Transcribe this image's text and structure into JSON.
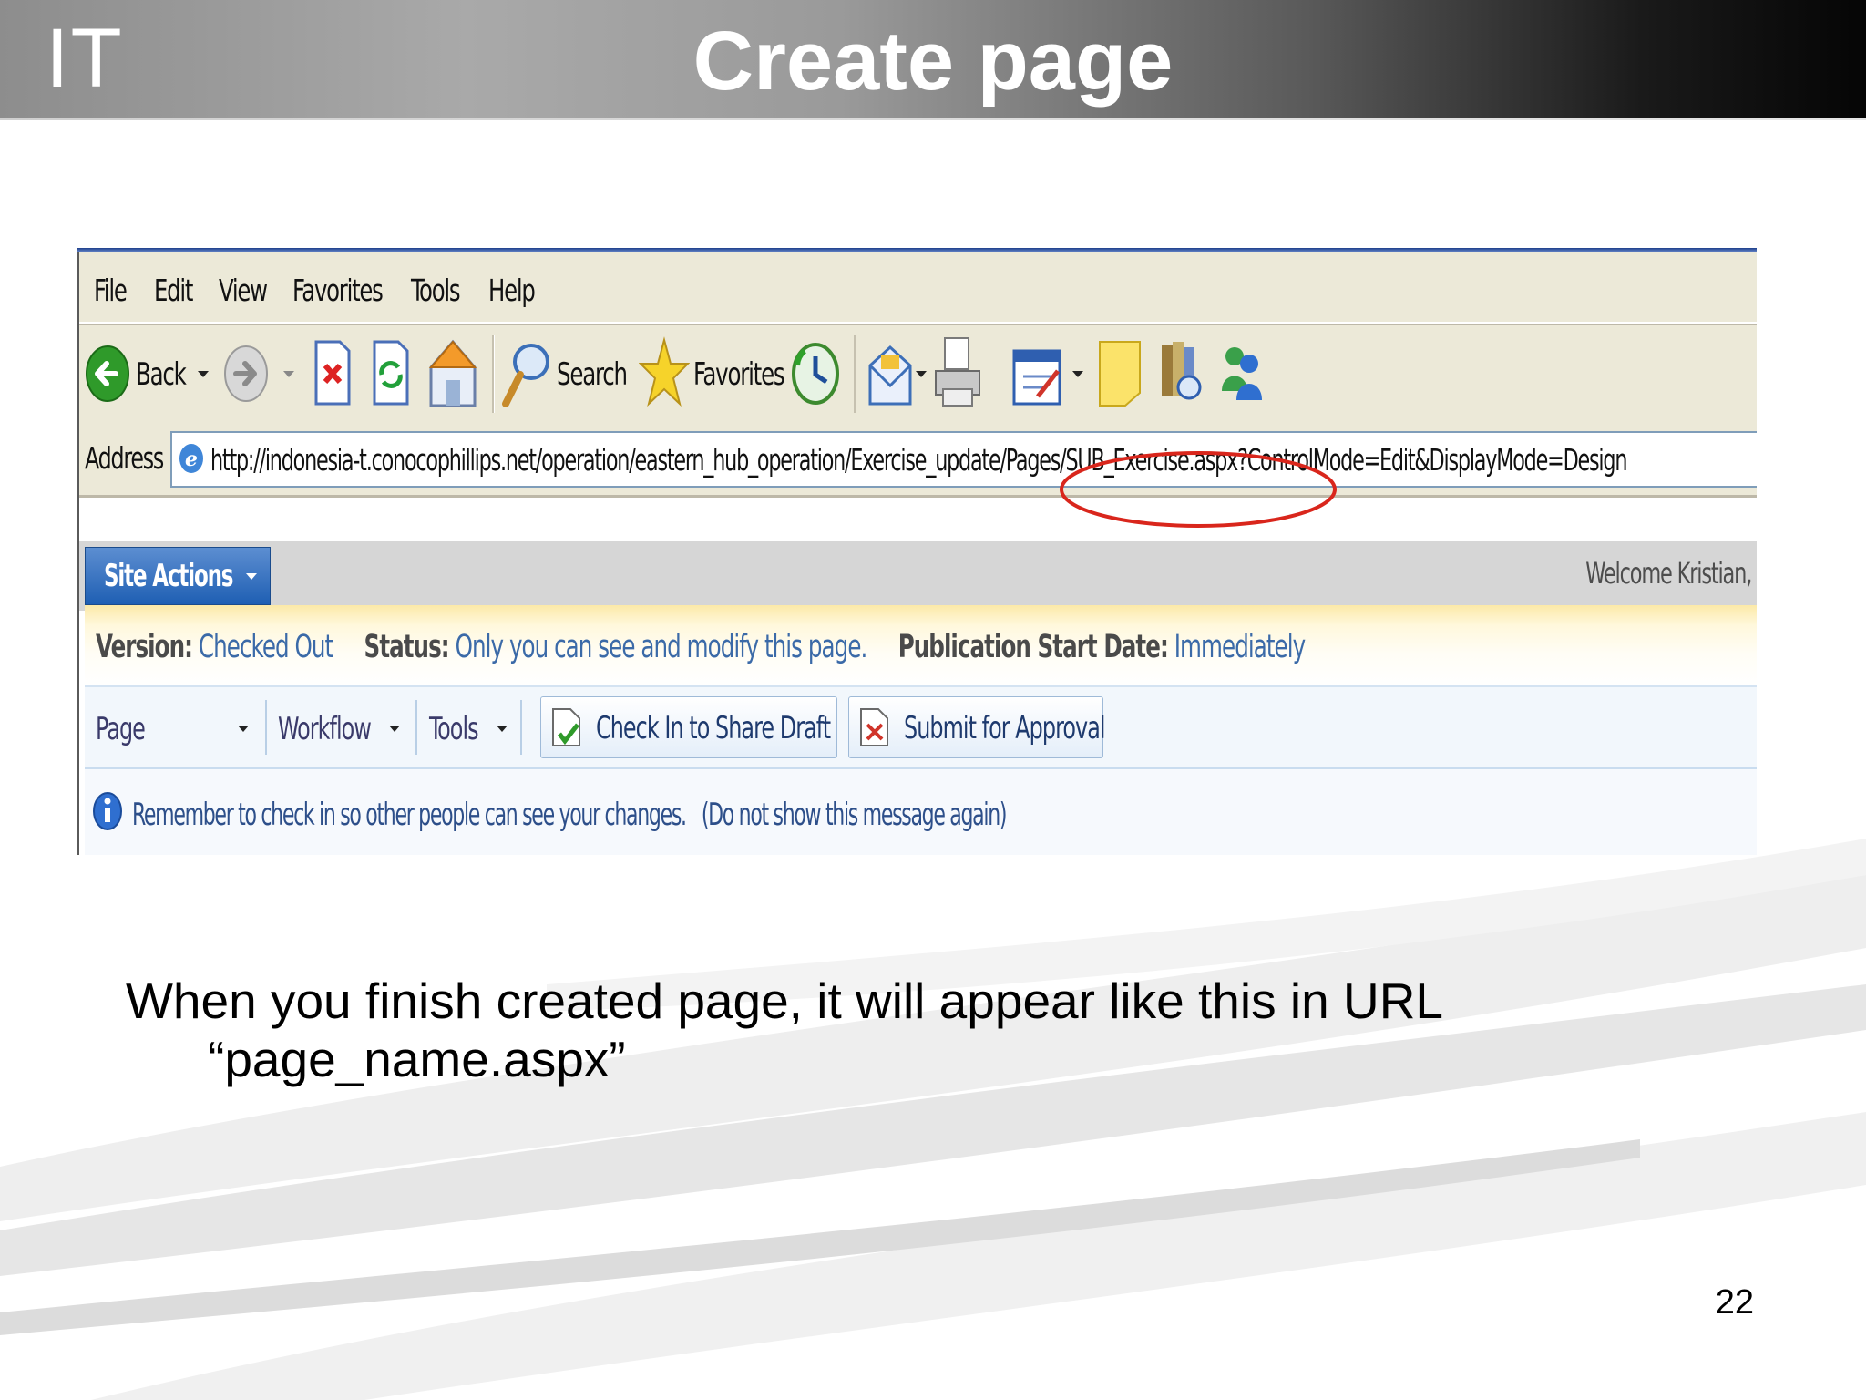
{
  "slide": {
    "logo": "IT",
    "title": "Create page",
    "caption_line1": "When you finish created page, it will appear like this in URL",
    "caption_line2": "“page_name.aspx”",
    "page_number": "22"
  },
  "browser": {
    "menu": [
      "File",
      "Edit",
      "View",
      "Favorites",
      "Tools",
      "Help"
    ],
    "toolbar": {
      "back_label": "Back",
      "search_label": "Search",
      "favorites_label": "Favorites"
    },
    "address_label": "Address",
    "address_url": "http://indonesia-t.conocophillips.net/operation/eastern_hub_operation/Exercise_update/Pages/SUB_Exercise.aspx?ControlMode=Edit&DisplayMode=Design",
    "highlight_color": "#d9261c"
  },
  "sharepoint": {
    "site_actions_label": "Site Actions",
    "welcome_text": "Welcome Kristian,",
    "status": {
      "version_key": "Version:",
      "version_value": "Checked Out",
      "status_key": "Status:",
      "status_value": "Only you can see and modify this page.",
      "pub_key": "Publication Start Date:",
      "pub_value": "Immediately"
    },
    "commands": {
      "page": "Page",
      "workflow": "Workflow",
      "tools": "Tools",
      "check_in": "Check In to Share Draft",
      "submit": "Submit for Approval"
    },
    "info_message": "Remember to check in so other people can see your changes.",
    "info_link": "(Do not show this message again)"
  }
}
